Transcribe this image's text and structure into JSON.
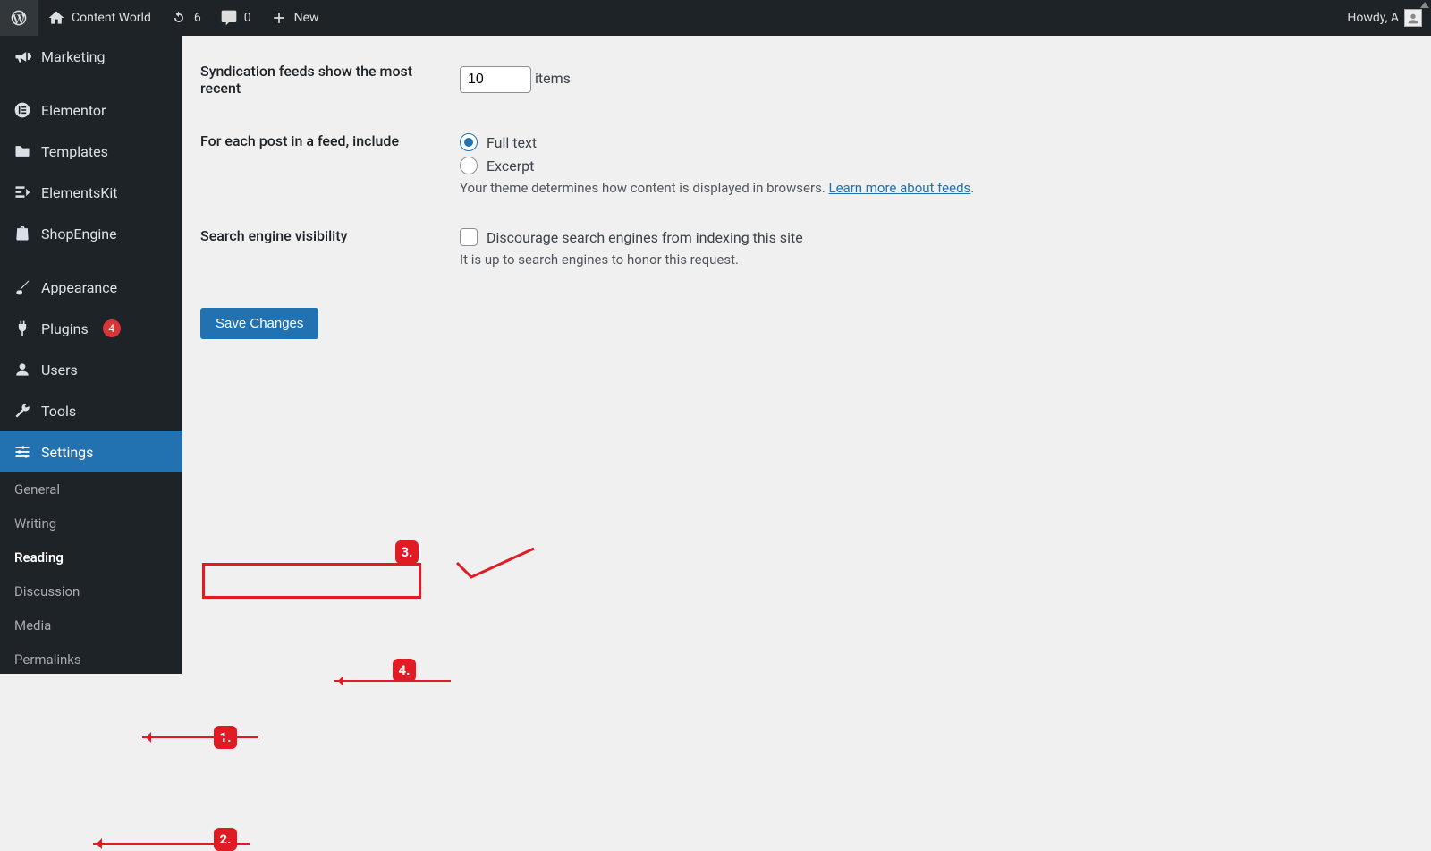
{
  "adminbar": {
    "site_title": "Content World",
    "updates_count": "6",
    "comments_count": "0",
    "new_label": "New",
    "greeting": "Howdy, A"
  },
  "sidebar": {
    "items": [
      {
        "label": "Marketing",
        "icon": "megaphone"
      },
      {
        "label": "Elementor",
        "icon": "elementor"
      },
      {
        "label": "Templates",
        "icon": "folder"
      },
      {
        "label": "ElementsKit",
        "icon": "elementskit"
      },
      {
        "label": "ShopEngine",
        "icon": "shopengine"
      },
      {
        "label": "Appearance",
        "icon": "brush"
      },
      {
        "label": "Plugins",
        "icon": "plug",
        "badge": "4"
      },
      {
        "label": "Users",
        "icon": "user"
      },
      {
        "label": "Tools",
        "icon": "wrench"
      },
      {
        "label": "Settings",
        "icon": "sliders",
        "current": true
      }
    ],
    "submenu": [
      {
        "label": "General"
      },
      {
        "label": "Writing"
      },
      {
        "label": "Reading",
        "current": true
      },
      {
        "label": "Discussion"
      },
      {
        "label": "Media"
      },
      {
        "label": "Permalinks"
      }
    ]
  },
  "settings": {
    "syndication": {
      "label": "Syndication feeds show the most recent",
      "value": "10",
      "unit": "items"
    },
    "feed_content": {
      "label": "For each post in a feed, include",
      "full_text": "Full text",
      "excerpt": "Excerpt",
      "note_prefix": "Your theme determines how content is displayed in browsers. ",
      "note_link": "Learn more about feeds",
      "note_suffix": "."
    },
    "visibility": {
      "label": "Search engine visibility",
      "checkbox": "Discourage search engines from indexing this site",
      "note": "It is up to search engines to honor this request."
    },
    "save": "Save Changes"
  },
  "annotations": {
    "n1": "1.",
    "n2": "2.",
    "n3": "3.",
    "n4": "4."
  }
}
